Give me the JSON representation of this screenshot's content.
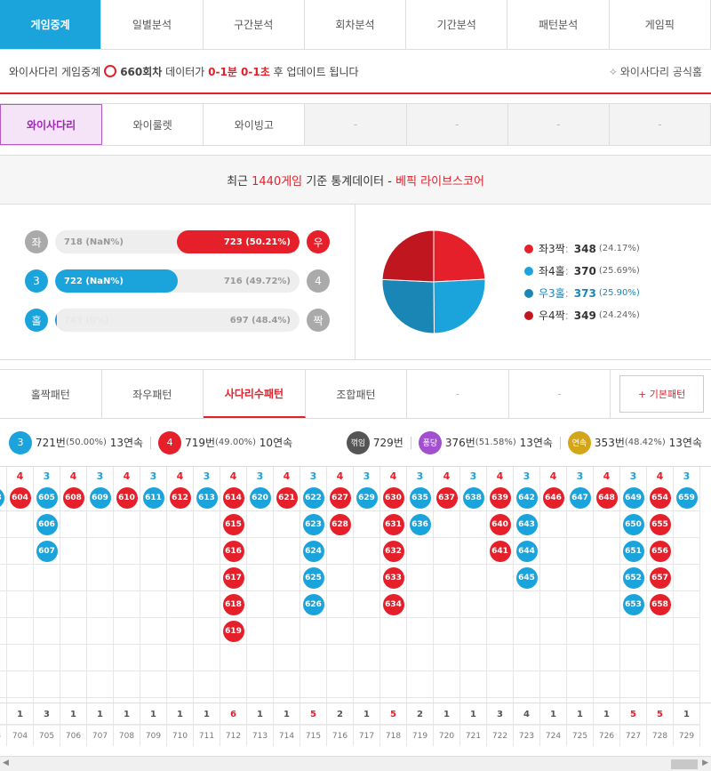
{
  "main_tabs": [
    "게임중계",
    "일별분석",
    "구간분석",
    "회차분석",
    "기간분석",
    "패턴분석",
    "게임픽"
  ],
  "info": {
    "prefix": "와이사다리 게임중계",
    "round": "660회차",
    "mid": "데이터가",
    "delay": "0-1분 0-1초",
    "suffix": "후 업데이트 됩니다",
    "official": "와이사다리 공식홈"
  },
  "sub_tabs": [
    "와이사다리",
    "와이룰렛",
    "와이빙고",
    "-",
    "-",
    "-",
    "-"
  ],
  "stats": {
    "prefix": "최근",
    "games": "1440게임",
    "mid": "기준 통계데이터 -",
    "source": "베픽 라이브스코어",
    "rows": [
      {
        "left_sym": "좌",
        "left_val": "718 (NaN%)",
        "right_val": "723 (50.21%)",
        "right_sym": "우",
        "fill": 0.5021,
        "fill_side": "right"
      },
      {
        "left_sym": "3",
        "left_val": "722 (NaN%)",
        "right_val": "716 (49.72%)",
        "right_sym": "4",
        "fill": 0.5028,
        "fill_side": "left"
      },
      {
        "left_sym": "홀",
        "left_val": "743 (0%)",
        "right_val": "697 (48.4%)",
        "right_sym": "짝",
        "fill": 0.0,
        "fill_side": "left"
      }
    ]
  },
  "pie": [
    {
      "label": "좌3짝",
      "num": "348",
      "pct": "(24.17%)",
      "color": "#e5202b"
    },
    {
      "label": "좌4홀",
      "num": "370",
      "pct": "(25.69%)",
      "color": "#1ba3dc"
    },
    {
      "label": "우3홀",
      "num": "373",
      "pct": "(25.90%)",
      "color": "#1a86b5"
    },
    {
      "label": "우4짝",
      "num": "349",
      "pct": "(24.24%)",
      "color": "#c0161f"
    }
  ],
  "pattern_tabs": [
    "홀짝패턴",
    "좌우패턴",
    "사다리수패턴",
    "조합패턴",
    "-",
    "-"
  ],
  "base_pattern": "+ 기본패턴",
  "summary": {
    "three": {
      "badge": "3",
      "count": "721번",
      "pct": "(50.00%)",
      "streak": "13연속"
    },
    "four": {
      "badge": "4",
      "count": "719번",
      "pct": "(49.00%)",
      "streak": "10연속"
    },
    "kkeok": {
      "badge": "꺾임",
      "count": "729번"
    },
    "pong": {
      "badge": "퐁당",
      "count": "376번",
      "pct": "(51.58%)",
      "streak": "13연속"
    },
    "yeon": {
      "badge": "연속",
      "count": "353번",
      "pct": "(48.42%)",
      "streak": "13연속"
    }
  },
  "columns": [
    {
      "h": "3",
      "c": "b",
      "balls": [
        "603"
      ],
      "cnt": "1",
      "rnd": "703"
    },
    {
      "h": "4",
      "c": "r",
      "balls": [
        "604"
      ],
      "cnt": "1",
      "rnd": "704"
    },
    {
      "h": "3",
      "c": "b",
      "balls": [
        "605",
        "606",
        "607"
      ],
      "cnt": "3",
      "rnd": "705"
    },
    {
      "h": "4",
      "c": "r",
      "balls": [
        "608"
      ],
      "cnt": "1",
      "rnd": "706"
    },
    {
      "h": "3",
      "c": "b",
      "balls": [
        "609"
      ],
      "cnt": "1",
      "rnd": "707"
    },
    {
      "h": "4",
      "c": "r",
      "balls": [
        "610"
      ],
      "cnt": "1",
      "rnd": "708"
    },
    {
      "h": "3",
      "c": "b",
      "balls": [
        "611"
      ],
      "cnt": "1",
      "rnd": "709"
    },
    {
      "h": "4",
      "c": "r",
      "balls": [
        "612"
      ],
      "cnt": "1",
      "rnd": "710"
    },
    {
      "h": "3",
      "c": "b",
      "balls": [
        "613"
      ],
      "cnt": "1",
      "rnd": "711"
    },
    {
      "h": "4",
      "c": "r",
      "balls": [
        "614",
        "615",
        "616",
        "617",
        "618",
        "619"
      ],
      "cnt": "6",
      "rnd": "712"
    },
    {
      "h": "3",
      "c": "b",
      "balls": [
        "620"
      ],
      "cnt": "1",
      "rnd": "713"
    },
    {
      "h": "4",
      "c": "r",
      "balls": [
        "621"
      ],
      "cnt": "1",
      "rnd": "714"
    },
    {
      "h": "3",
      "c": "b",
      "balls": [
        "622",
        "623",
        "624",
        "625",
        "626"
      ],
      "cnt": "5",
      "rnd": "715"
    },
    {
      "h": "4",
      "c": "r",
      "balls": [
        "627",
        "628"
      ],
      "cnt": "2",
      "rnd": "716"
    },
    {
      "h": "3",
      "c": "b",
      "balls": [
        "629"
      ],
      "cnt": "1",
      "rnd": "717"
    },
    {
      "h": "4",
      "c": "r",
      "balls": [
        "630",
        "631",
        "632",
        "633",
        "634"
      ],
      "cnt": "5",
      "rnd": "718"
    },
    {
      "h": "3",
      "c": "b",
      "balls": [
        "635",
        "636"
      ],
      "cnt": "2",
      "rnd": "719"
    },
    {
      "h": "4",
      "c": "r",
      "balls": [
        "637"
      ],
      "cnt": "1",
      "rnd": "720"
    },
    {
      "h": "3",
      "c": "b",
      "balls": [
        "638"
      ],
      "cnt": "1",
      "rnd": "721"
    },
    {
      "h": "4",
      "c": "r",
      "balls": [
        "639",
        "640",
        "641"
      ],
      "cnt": "3",
      "rnd": "722"
    },
    {
      "h": "3",
      "c": "b",
      "balls": [
        "642",
        "643",
        "644",
        "645"
      ],
      "cnt": "4",
      "rnd": "723"
    },
    {
      "h": "4",
      "c": "r",
      "balls": [
        "646"
      ],
      "cnt": "1",
      "rnd": "724"
    },
    {
      "h": "3",
      "c": "b",
      "balls": [
        "647"
      ],
      "cnt": "1",
      "rnd": "725"
    },
    {
      "h": "4",
      "c": "r",
      "balls": [
        "648"
      ],
      "cnt": "1",
      "rnd": "726"
    },
    {
      "h": "3",
      "c": "b",
      "balls": [
        "649",
        "650",
        "651",
        "652",
        "653"
      ],
      "cnt": "5",
      "rnd": "727"
    },
    {
      "h": "4",
      "c": "r",
      "balls": [
        "654",
        "655",
        "656",
        "657",
        "658"
      ],
      "cnt": "5",
      "rnd": "728"
    },
    {
      "h": "3",
      "c": "b",
      "balls": [
        "659"
      ],
      "cnt": "1",
      "rnd": "729"
    }
  ]
}
